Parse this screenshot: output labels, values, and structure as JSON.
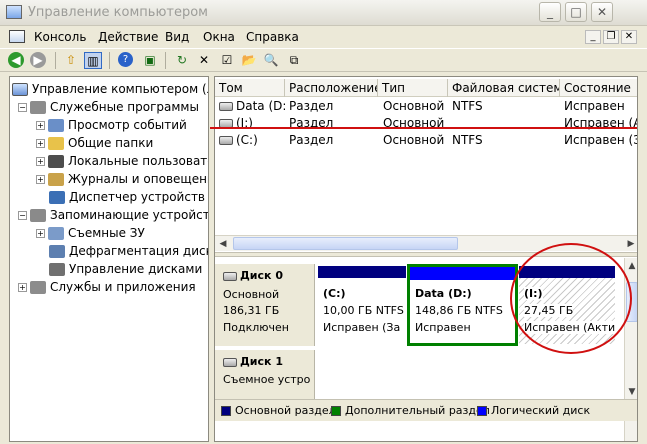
{
  "window": {
    "title": "Управление компьютером"
  },
  "menubar": {
    "items": [
      "Консоль",
      "Действие",
      "Вид",
      "Окна",
      "Справка"
    ]
  },
  "tree": {
    "root": "Управление компьютером (лок",
    "items": [
      {
        "label": "Служебные программы",
        "icon": "tools-icon"
      },
      {
        "label": "Просмотр событий",
        "icon": "event-viewer-icon"
      },
      {
        "label": "Общие папки",
        "icon": "shared-folder-icon"
      },
      {
        "label": "Локальные пользовател",
        "icon": "users-icon"
      },
      {
        "label": "Журналы и оповещения",
        "icon": "logs-icon"
      },
      {
        "label": "Диспетчер устройств",
        "icon": "device-manager-icon"
      },
      {
        "label": "Запоминающие устройства",
        "icon": "storage-icon"
      },
      {
        "label": "Съемные ЗУ",
        "icon": "removable-storage-icon"
      },
      {
        "label": "Дефрагментация диска",
        "icon": "defrag-icon"
      },
      {
        "label": "Управление дисками",
        "icon": "disk-management-icon"
      },
      {
        "label": "Службы и приложения",
        "icon": "services-icon"
      }
    ]
  },
  "volumes": {
    "columns": [
      "Том",
      "Расположение",
      "Тип",
      "Файловая система",
      "Состояние"
    ],
    "rows": [
      {
        "name": "Data (D:)",
        "layout": "Раздел",
        "type": "Основной",
        "fs": "NTFS",
        "status": "Исправен"
      },
      {
        "name": "(I:)",
        "layout": "Раздел",
        "type": "Основной",
        "fs": "",
        "status": "Исправен (Ак"
      },
      {
        "name": "(C:)",
        "layout": "Раздел",
        "type": "Основной",
        "fs": "NTFS",
        "status": "Исправен (За"
      }
    ]
  },
  "disks": [
    {
      "name": "Диск 0",
      "kind": "Основной",
      "size": "186,31 ГБ",
      "state": "Подключен",
      "partitions": [
        {
          "name": "(C:)",
          "size": "10,00 ГБ NTFS",
          "status": "Исправен (За"
        },
        {
          "name": "Data (D:)",
          "size": "148,86 ГБ NTFS",
          "status": "Исправен"
        },
        {
          "name": "(I:)",
          "size": "27,45 ГБ",
          "status": "Исправен (Акти"
        }
      ]
    },
    {
      "name": "Диск 1",
      "kind": "Съемное устро"
    }
  ],
  "legend": [
    {
      "label": "Основной раздел",
      "color": "#00007f"
    },
    {
      "label": "Дополнительный раздел",
      "color": "#008000"
    },
    {
      "label": "Логический диск",
      "color": "#0000ff"
    }
  ],
  "colors": {
    "primary": "#00007f",
    "extended": "#008000",
    "logical": "#0000ff",
    "annotation": "#d01010"
  }
}
